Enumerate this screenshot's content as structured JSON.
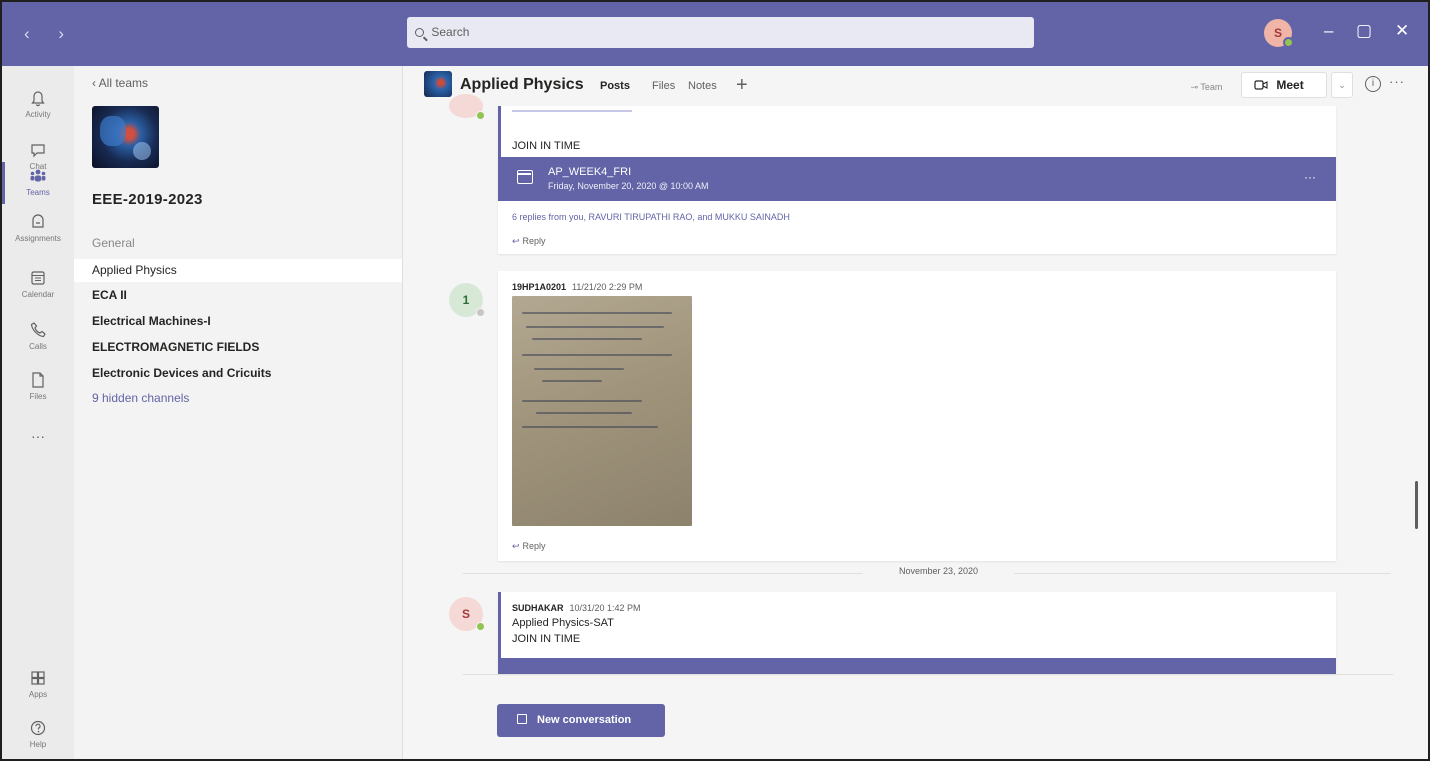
{
  "titlebar": {
    "nav": "‹ ›",
    "search_placeholder": "Search",
    "user_initial": "S",
    "minimize": "–",
    "maximize": "▢",
    "close": "✕"
  },
  "rail": [
    {
      "label": "Activity",
      "icon": "bell-icon"
    },
    {
      "label": "Chat",
      "icon": "chat-icon"
    },
    {
      "label": "Teams",
      "icon": "teams-icon"
    },
    {
      "label": "Assignments",
      "icon": "assignments-icon"
    },
    {
      "label": "Calendar",
      "icon": "calendar-icon"
    },
    {
      "label": "Calls",
      "icon": "phone-icon"
    },
    {
      "label": "Files",
      "icon": "file-icon"
    },
    {
      "label": "Apps",
      "icon": "apps-icon"
    },
    {
      "label": "Help",
      "icon": "help-icon"
    }
  ],
  "rail_more": "···",
  "sidebar": {
    "back": "‹  All teams",
    "team_name": "EEE-2019-2023",
    "channels": [
      {
        "label": "General",
        "style": "muted"
      },
      {
        "label": "Applied Physics",
        "style": "selected"
      },
      {
        "label": "ECA II",
        "style": "bold"
      },
      {
        "label": "Electrical Machines-I",
        "style": "bold"
      },
      {
        "label": "ELECTROMAGNETIC FIELDS",
        "style": "bold"
      },
      {
        "label": "Electronic Devices and Cricuits",
        "style": "bold"
      },
      {
        "label": "9 hidden channels",
        "style": "link"
      }
    ]
  },
  "header": {
    "title": "Applied Physics",
    "tabs": [
      "Posts",
      "Files",
      "Notes"
    ],
    "add_tab": "+",
    "team_button": "⊸ Team",
    "meet_label": "Meet",
    "meet_dropdown": "⌄",
    "info": "i",
    "more": "···"
  },
  "posts": [
    {
      "body": "JOIN IN TIME",
      "meeting_title": "AP_WEEK4_FRI",
      "meeting_time": "Friday, November 20, 2020 @ 10:00 AM",
      "meeting_more": "···",
      "replies": "6 replies from you, RAVURI TIRUPATHI RAO, and MUKKU SAINADH",
      "reply_label": "Reply"
    },
    {
      "avatar": "1",
      "author": "19HP1A0201",
      "time": "11/21/20 2:29 PM",
      "reply_label": "Reply"
    },
    {
      "avatar": "S",
      "author": "SUDHAKAR",
      "time": "10/31/20 1:42 PM",
      "line1": "Applied Physics-SAT",
      "line2": "JOIN IN TIME"
    }
  ],
  "date_separator": "November 23, 2020",
  "new_conversation": "New conversation",
  "colors": {
    "brand": "#6264a7",
    "rail_bg": "#ebebeb",
    "list_bg": "#f3f3f3",
    "presence": "#92c353"
  }
}
